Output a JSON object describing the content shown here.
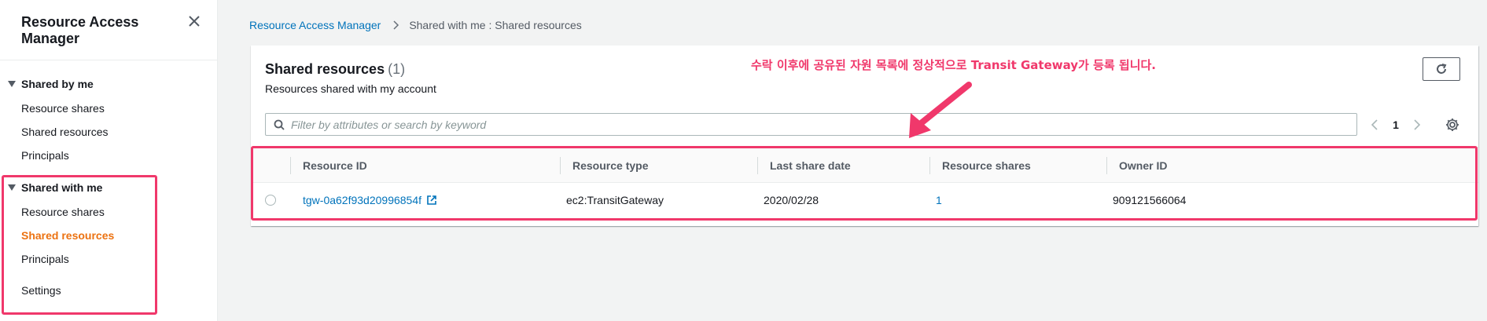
{
  "sidebar": {
    "title": "Resource Access Manager",
    "sections": [
      {
        "label": "Shared by me",
        "items": [
          {
            "label": "Resource shares"
          },
          {
            "label": "Shared resources"
          },
          {
            "label": "Principals"
          }
        ]
      },
      {
        "label": "Shared with me",
        "items": [
          {
            "label": "Resource shares"
          },
          {
            "label": "Shared resources",
            "active": true
          },
          {
            "label": "Principals"
          }
        ]
      }
    ],
    "settings_label": "Settings"
  },
  "breadcrumb": {
    "root": "Resource Access Manager",
    "current": "Shared with me : Shared resources"
  },
  "panel": {
    "title": "Shared resources",
    "count": "(1)",
    "description": "Resources shared with my account",
    "search_placeholder": "Filter by attributes or search by keyword",
    "page": "1"
  },
  "table": {
    "columns": [
      "Resource ID",
      "Resource type",
      "Last share date",
      "Resource shares",
      "Owner ID"
    ],
    "rows": [
      {
        "resource_id": "tgw-0a62f93d20996854f",
        "resource_type": "ec2:TransitGateway",
        "last_share_date": "2020/02/28",
        "resource_shares": "1",
        "owner_id": "909121566064"
      }
    ]
  },
  "annotation": {
    "text": "수락 이후에 공유된 자원 목록에 정상적으로 Transit Gateway가 등록 됩니다.",
    "color": "#f0386b"
  },
  "colors": {
    "link": "#0073bb",
    "active_nav": "#ec7211",
    "highlight": "#f0386b"
  }
}
